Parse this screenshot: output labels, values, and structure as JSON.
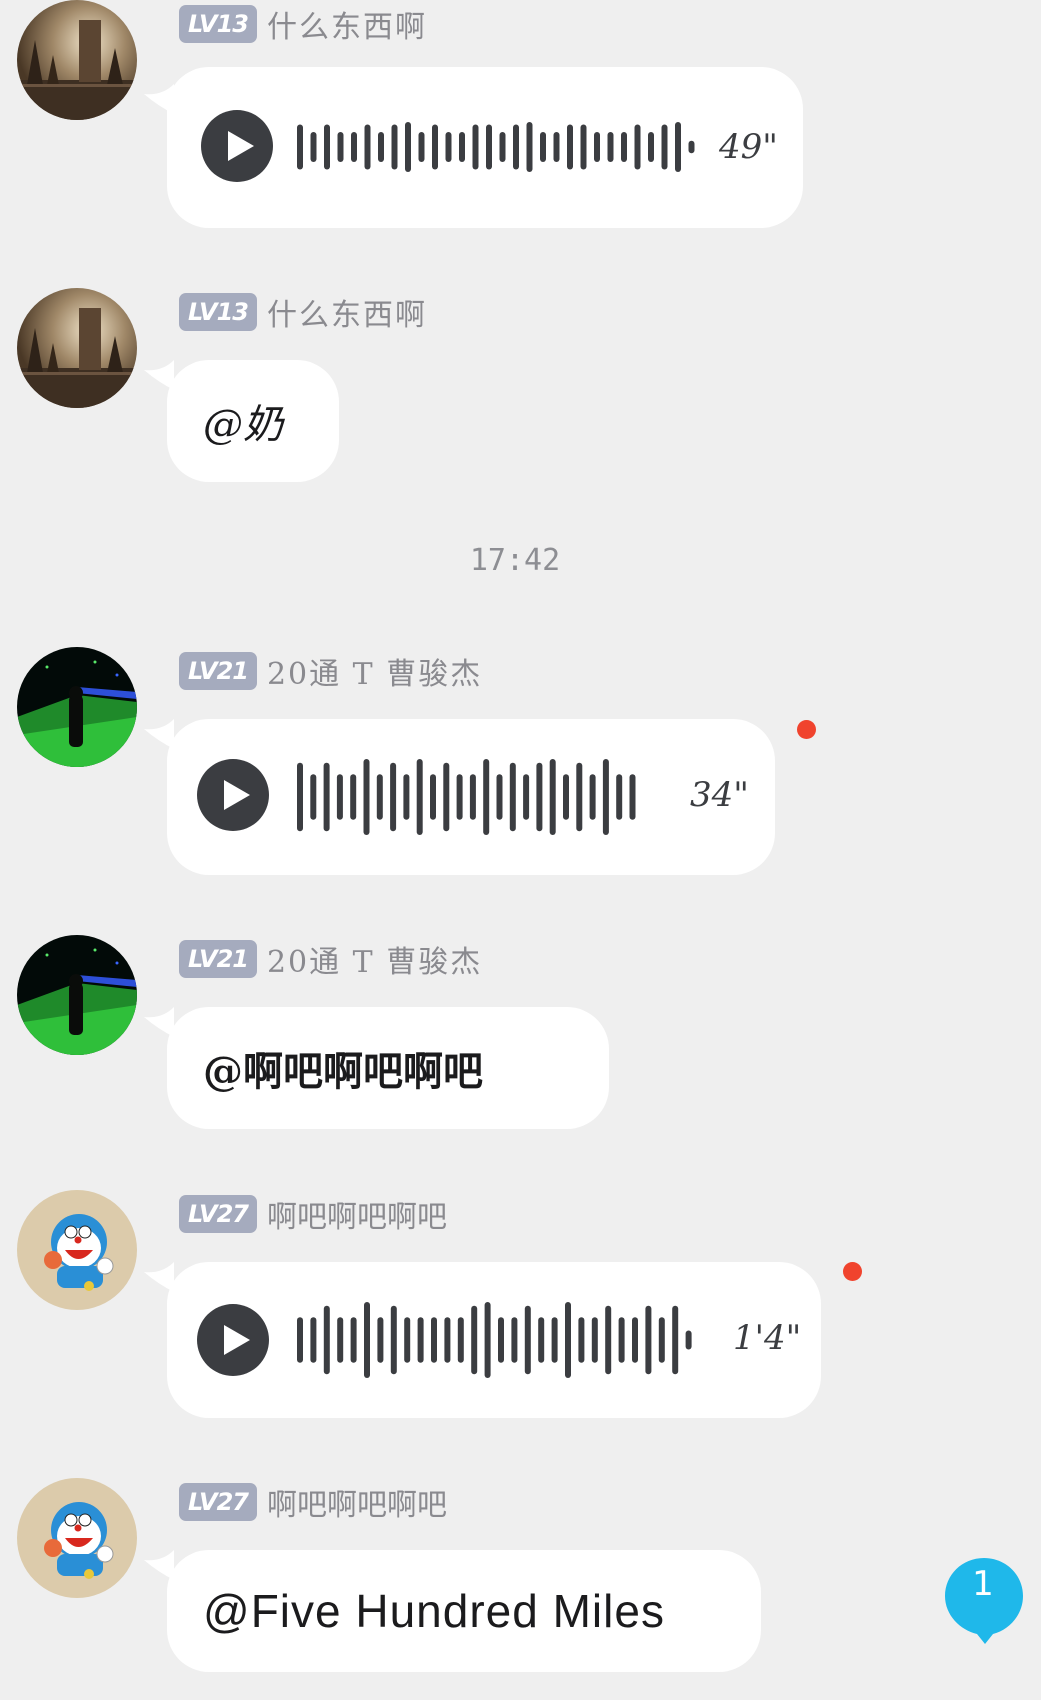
{
  "messages": [
    {
      "level": "LV13",
      "nickname": "什么东西啊",
      "avatar": "sepia-park-photo",
      "type": "voice",
      "duration": "49\"",
      "unread": false
    },
    {
      "level": "LV13",
      "nickname": "什么东西啊",
      "avatar": "sepia-park-photo",
      "type": "text",
      "text": "@奶"
    },
    {
      "level": "LV21",
      "nickname": "20通 T 曹骏杰",
      "avatar": "green-light-tunnel-photo",
      "type": "voice",
      "duration": "34\"",
      "unread": true
    },
    {
      "level": "LV21",
      "nickname": "20通 T 曹骏杰",
      "avatar": "green-light-tunnel-photo",
      "type": "text",
      "text": "@啊吧啊吧啊吧"
    },
    {
      "level": "LV27",
      "nickname": "啊吧啊吧啊吧",
      "avatar": "doraemon-cartoon",
      "type": "voice",
      "duration": "1'4\"",
      "unread": true
    },
    {
      "level": "LV27",
      "nickname": "啊吧啊吧啊吧",
      "avatar": "doraemon-cartoon",
      "type": "text",
      "text": "@Five Hundred Miles"
    }
  ],
  "timestamp": "17:42",
  "scroll_to_new": {
    "count": "1",
    "icon": "new-message-count-icon"
  },
  "colors": {
    "background": "#efefef",
    "bubble": "#ffffff",
    "level_badge": "#a5abbe",
    "unread_dot": "#f0432d",
    "fab": "#1fb8ea",
    "voice_dark": "#3b3d41"
  }
}
